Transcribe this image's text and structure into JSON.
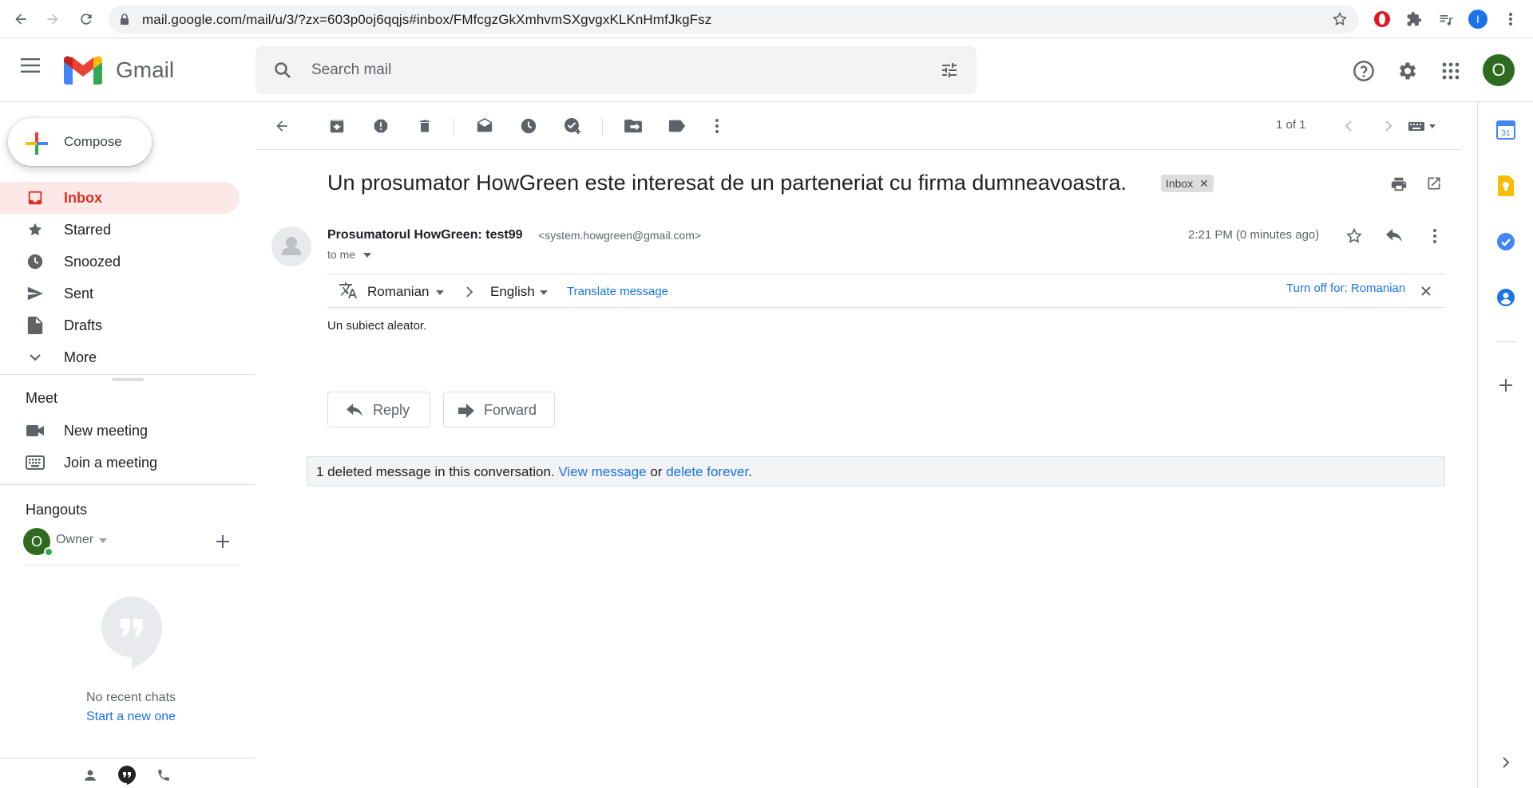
{
  "browser": {
    "url": "mail.google.com/mail/u/3/?zx=603p0oj6qqjs#inbox/FMfcgzGkXmhvmSXgvgxKLKnHmfJkgFsz",
    "profile_initial": "I"
  },
  "header": {
    "app_name": "Gmail",
    "search_placeholder": "Search mail",
    "account_initial": "O"
  },
  "sidebar": {
    "compose_label": "Compose",
    "items": [
      {
        "label": "Inbox",
        "icon": "inbox-icon",
        "active": true
      },
      {
        "label": "Starred",
        "icon": "star-icon"
      },
      {
        "label": "Snoozed",
        "icon": "clock-icon"
      },
      {
        "label": "Sent",
        "icon": "send-icon"
      },
      {
        "label": "Drafts",
        "icon": "draft-icon"
      },
      {
        "label": "More",
        "icon": "chevron-down-icon"
      }
    ],
    "meet": {
      "title": "Meet",
      "new_meeting": "New meeting",
      "join_meeting": "Join a meeting"
    },
    "hangouts": {
      "title": "Hangouts",
      "owner_initial": "O",
      "owner_name": "Owner",
      "no_chats": "No recent chats",
      "start_new": "Start a new one"
    }
  },
  "toolbar": {
    "pager": "1 of 1"
  },
  "message": {
    "subject": "Un prosumator HowGreen este interesat de un parteneriat cu firma dumneavoastra.",
    "label_chip": "Inbox",
    "sender_name": "Prosumatorul HowGreen: test99",
    "sender_email": "<system.howgreen@gmail.com>",
    "recipient": "to me",
    "time": "2:21 PM (0 minutes ago)",
    "translate": {
      "from": "Romanian",
      "to": "English",
      "action": "Translate message",
      "turn_off": "Turn off for: Romanian"
    },
    "body": "Un subiect aleator.",
    "reply_label": "Reply",
    "forward_label": "Forward",
    "deleted_note": {
      "prefix": "1 deleted message in this conversation.",
      "view_link": "View message",
      "or": "or",
      "delete_link": "delete forever",
      "suffix": "."
    }
  },
  "colors": {
    "accent_red": "#d93025",
    "active_bg": "#fce8e6",
    "link_blue": "#1a73e8",
    "avatar_green": "#2e6b1f"
  }
}
